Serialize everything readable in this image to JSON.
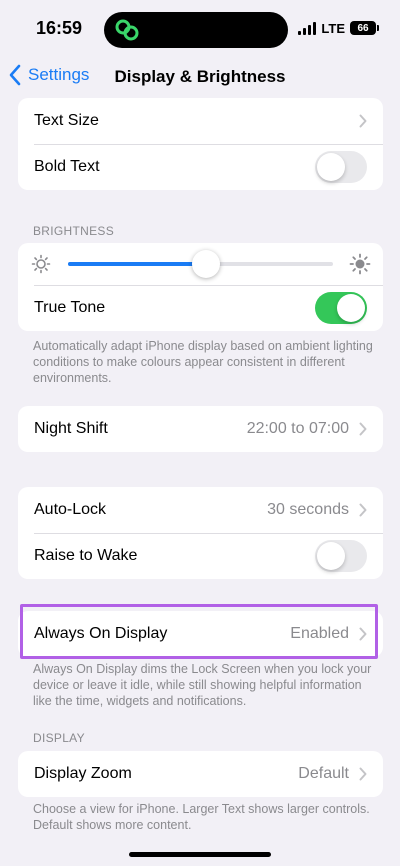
{
  "status_bar": {
    "time": "16:59",
    "network": "LTE",
    "battery": "66"
  },
  "nav": {
    "back_label": "Settings",
    "title": "Display & Brightness"
  },
  "text_group": {
    "text_size_label": "Text Size",
    "bold_text_label": "Bold Text",
    "bold_text_on": false
  },
  "brightness": {
    "header": "BRIGHTNESS",
    "level_percent": 52,
    "true_tone_label": "True Tone",
    "true_tone_on": true,
    "footer": "Automatically adapt iPhone display based on ambient lighting conditions to make colours appear consistent in different environments."
  },
  "night_shift": {
    "label": "Night Shift",
    "value": "22:00 to 07:00"
  },
  "lock": {
    "auto_lock_label": "Auto-Lock",
    "auto_lock_value": "30 seconds",
    "raise_to_wake_label": "Raise to Wake",
    "raise_to_wake_on": false
  },
  "always_on": {
    "label": "Always On Display",
    "value": "Enabled",
    "footer": "Always On Display dims the Lock Screen when you lock your device or leave it idle, while still showing helpful information like the time, widgets and notifications."
  },
  "display": {
    "header": "DISPLAY",
    "zoom_label": "Display Zoom",
    "zoom_value": "Default",
    "footer": "Choose a view for iPhone. Larger Text shows larger controls. Default shows more content."
  },
  "colors": {
    "accent": "#1a7cf5",
    "toggle_on": "#34c759",
    "highlight": "#b160e6",
    "background": "#f2f0f6"
  }
}
